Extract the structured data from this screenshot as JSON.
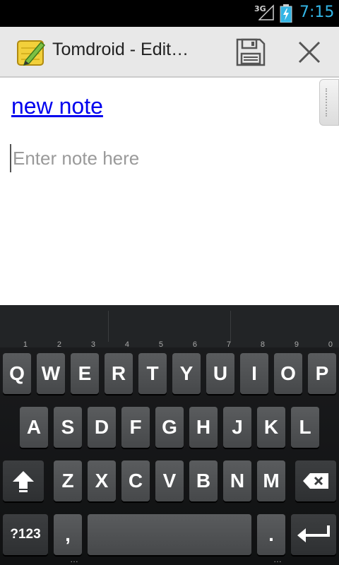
{
  "status_bar": {
    "network": "3G",
    "clock": "7:15"
  },
  "action_bar": {
    "app_icon": "pencil-notepad-icon",
    "title": "Tomdroid - Edit…",
    "save_icon": "floppy-disk-icon",
    "close_icon": "close-x-icon"
  },
  "note": {
    "title": "new note",
    "body_value": "",
    "body_placeholder": "Enter note here"
  },
  "keyboard": {
    "row1": [
      {
        "label": "Q",
        "hint": "1"
      },
      {
        "label": "W",
        "hint": "2"
      },
      {
        "label": "E",
        "hint": "3"
      },
      {
        "label": "R",
        "hint": "4"
      },
      {
        "label": "T",
        "hint": "5"
      },
      {
        "label": "Y",
        "hint": "6"
      },
      {
        "label": "U",
        "hint": "7"
      },
      {
        "label": "I",
        "hint": "8"
      },
      {
        "label": "O",
        "hint": "9"
      },
      {
        "label": "P",
        "hint": "0"
      }
    ],
    "row2": [
      "A",
      "S",
      "D",
      "F",
      "G",
      "H",
      "J",
      "K",
      "L"
    ],
    "row3": [
      "Z",
      "X",
      "C",
      "V",
      "B",
      "N",
      "M"
    ],
    "symbols_label": "?123",
    "comma_label": ",",
    "period_label": ".",
    "more_indicator": "…",
    "shift_icon": "shift-arrow-icon",
    "delete_icon": "backspace-icon",
    "enter_icon": "enter-return-icon"
  },
  "colors": {
    "clock": "#33b5e5",
    "link": "#0000ee",
    "keyboard_bg": "#141516",
    "key": "#505254"
  }
}
